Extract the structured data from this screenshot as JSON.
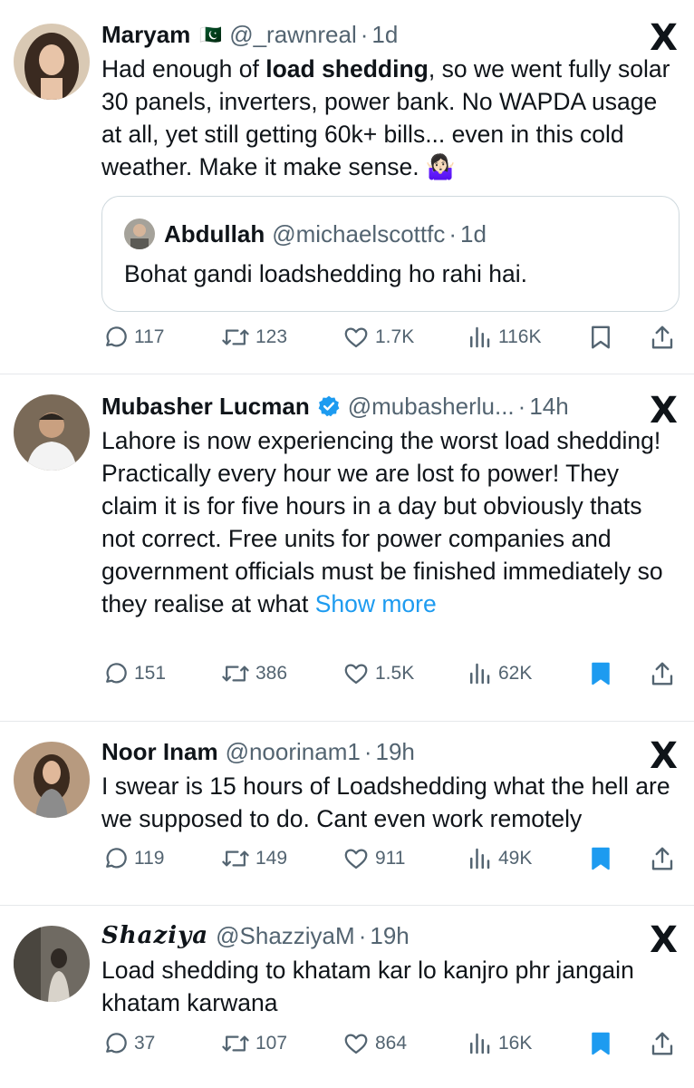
{
  "colors": {
    "accent": "#1d9bf0",
    "text": "#0f1419",
    "muted": "#536471",
    "border": "#cfd9de"
  },
  "tweets": [
    {
      "name": "Maryam",
      "flag": "🇵🇰",
      "handle": "@_rawnreal",
      "time": "1d",
      "text_before": "Had enough of ",
      "text_bold": "load shedding",
      "text_after": ", so we went fully solar 30 panels, inverters, power bank. No WAPDA usage at all, yet still getting 60k+ bills... even in this cold weather. Make it make sense. 🤷🏻‍♀️",
      "quote": {
        "name": "Abdullah",
        "handle": "@michaelscottfc",
        "time": "1d",
        "text": "Bohat gandi loadshedding ho rahi hai."
      },
      "replies": "117",
      "reposts": "123",
      "likes": "1.7K",
      "views": "116K",
      "bookmarked": false
    },
    {
      "name": "Mubasher Lucman",
      "verified": true,
      "handle": "@mubasherlu...",
      "time": "14h",
      "text": "Lahore is now experiencing the worst load shedding! Practically every hour we are lost fo power! They claim it is for five hours in a day but obviously thats not correct. Free units for power companies and government officials must be finished immediately so they realise at what ",
      "show_more": "Show more",
      "replies": "151",
      "reposts": "386",
      "likes": "1.5K",
      "views": "62K",
      "bookmarked": true
    },
    {
      "name": "Noor Inam",
      "handle": "@noorinam1",
      "time": "19h",
      "text": "I swear is 15 hours of Loadshedding what the hell are we supposed to do. Cant even work remotely",
      "replies": "119",
      "reposts": "149",
      "likes": "911",
      "views": "49K",
      "bookmarked": true
    },
    {
      "name": "𝑺𝒉𝒂𝒛𝒊𝒚𝒂",
      "handle": "@ShazziyaM",
      "time": "19h",
      "text": "Load shedding to khatam kar lo kanjro phr jangain khatam karwana",
      "replies": "37",
      "reposts": "107",
      "likes": "864",
      "views": "16K",
      "bookmarked": true
    }
  ],
  "dot": "·",
  "x_logo": "X"
}
